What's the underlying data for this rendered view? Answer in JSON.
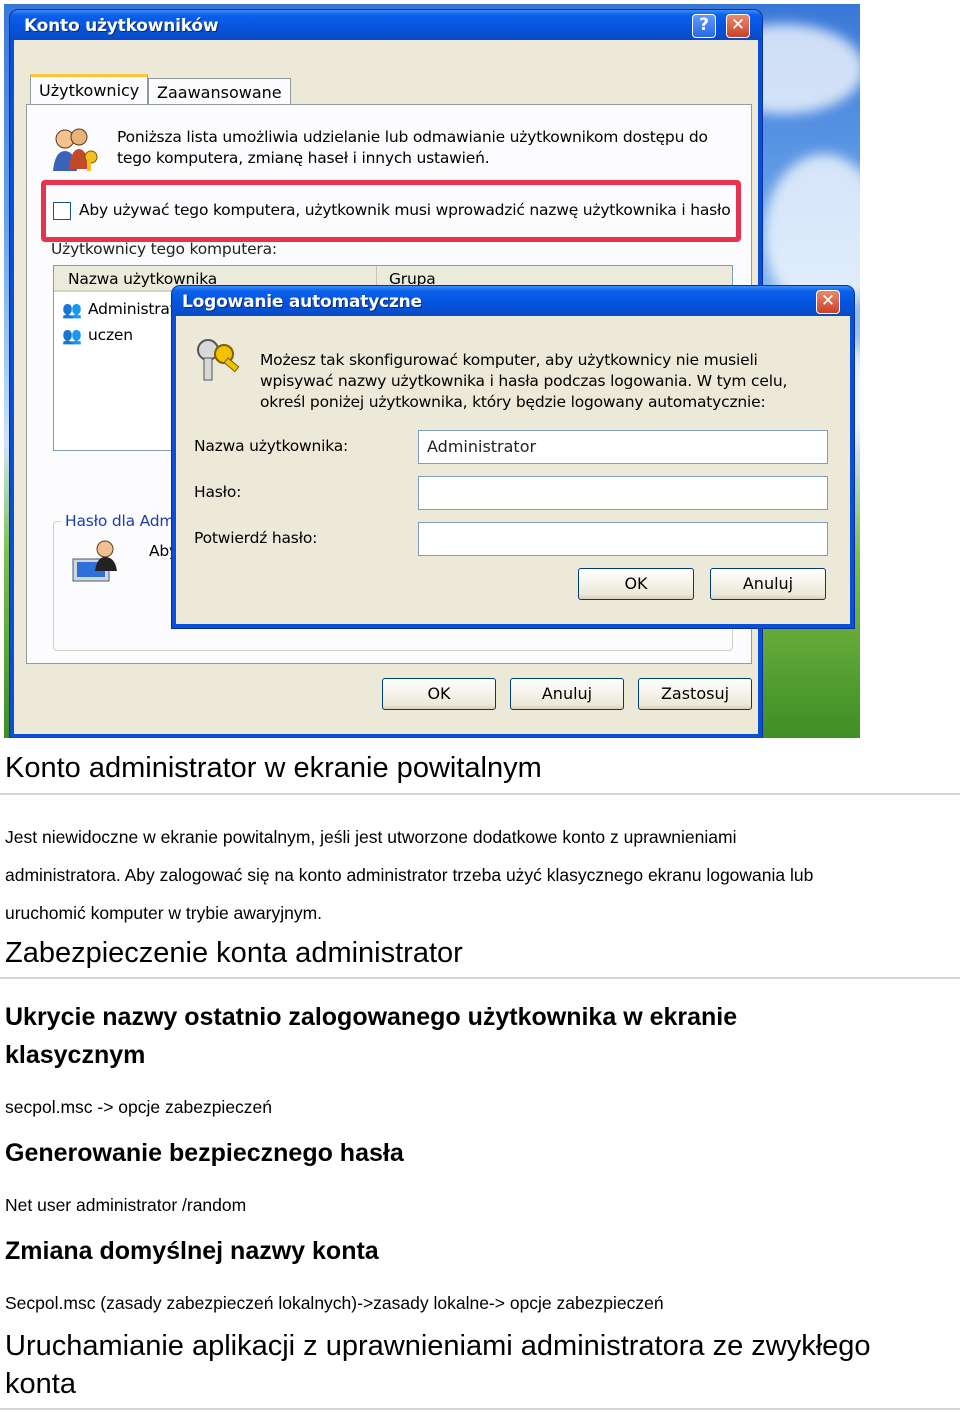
{
  "screenshot": {
    "main_window": {
      "title": "Konto użytkowników",
      "tabs": [
        "Użytkownicy",
        "Zaawansowane"
      ],
      "intro": "Poniższa lista umożliwia udzielanie lub odmawianie użytkownikom dostępu do tego komputera, zmianę haseł i innych ustawień.",
      "checkbox_label": "Aby używać tego komputera, użytkownik musi wprowadzić nazwę użytkownika i hasło",
      "users_label": "Użytkownicy tego komputera:",
      "columns": [
        "Nazwa użytkownika",
        "Grupa"
      ],
      "users": [
        "Administrat",
        "uczen"
      ],
      "password_group_label": "Hasło dla Admi",
      "password_group_text": "Aby z",
      "buttons": {
        "ok": "OK",
        "cancel": "Anuluj",
        "apply": "Zastosuj"
      }
    },
    "dialog": {
      "title": "Logowanie automatyczne",
      "description": "Możesz tak skonfigurować komputer, aby użytkownicy nie musieli wpisywać nazwy użytkownika i hasła podczas logowania. W tym celu, określ poniżej użytkownika, który będzie logowany automatycznie:",
      "username_label": "Nazwa użytkownika:",
      "username_value": "Administrator",
      "password_label": "Hasło:",
      "confirm_label": "Potwierdź hasło:",
      "buttons": {
        "ok": "OK",
        "cancel": "Anuluj"
      }
    },
    "highlight_color": "#e8334f"
  },
  "article": {
    "h1": "Konto administrator w ekranie powitalnym",
    "p1_lines": [
      "Jest niewidoczne w ekranie powitalnym, jeśli jest utworzone dodatkowe konto z uprawnieniami",
      "administratora. Aby zalogować się na konto administrator trzeba użyć klasycznego ekranu logowania lub",
      "uruchomić komputer w trybie awaryjnym."
    ],
    "h2": "Zabezpieczenie konta administrator",
    "h3a_lines": [
      "Ukrycie nazwy ostatnio zalogowanego użytkownika w ekranie",
      "klasycznym"
    ],
    "p2": "secpol.msc -> opcje zabezpieczeń",
    "h3b": "Generowanie bezpiecznego hasła",
    "p3": "Net user administrator /random",
    "h3c": "Zmiana domyślnej nazwy konta",
    "p4": "Secpol.msc (zasady zabezpieczeń lokalnych)->zasady lokalne-> opcje zabezpieczeń",
    "h4_lines": [
      "Uruchamianie aplikacji z uprawnieniami administratora ze zwykłego",
      "konta"
    ]
  }
}
